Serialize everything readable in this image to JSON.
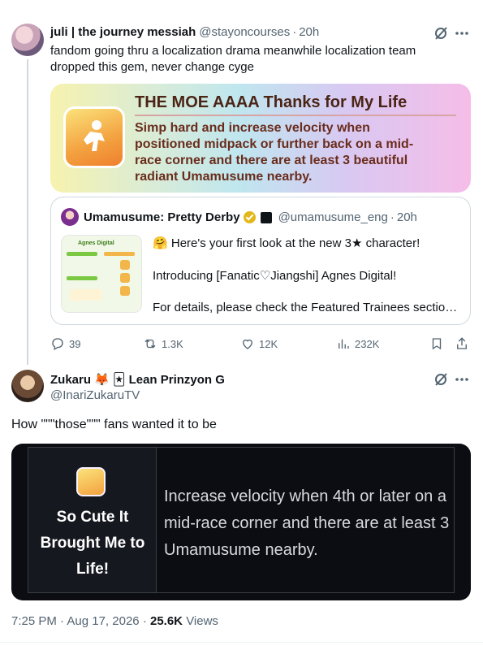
{
  "tweet1": {
    "display_name": "juli | the journey messiah",
    "handle": "@stayoncourses",
    "time": "20h",
    "text": "fandom going thru a localization drama meanwhile localization team dropped this gem, never change cyge",
    "image": {
      "title": "THE MOE AAAA Thanks for My Life",
      "body": "Simp hard and increase velocity when positioned midpack or further back on a mid-race corner and there are at least 3 beautiful radiant Umamusume nearby."
    },
    "quote": {
      "display_name": "Umamusume: Pretty Derby",
      "handle": "@umamusume_eng",
      "time": "20h",
      "thumb_title": "Agnes Digital",
      "lines": [
        "Here's your first look at the new 3★ character!",
        "Introducing [Fanatic♡Jiangshi] Agnes Digital!",
        "For details, please check the Featured Trainees sectio…"
      ]
    },
    "actions": {
      "replies": "39",
      "reposts": "1.3K",
      "likes": "12K",
      "views": "232K"
    }
  },
  "tweet2": {
    "display_name_a": "Zukaru",
    "display_name_b": "Lean Prinzyon G",
    "handle": "@InariZukaruTV",
    "text": "How \"\"\"those\"\"\" fans wanted it to be",
    "image": {
      "title": "So Cute It Brought Me to Life!",
      "desc": "Increase velocity when 4th or later on a mid-race corner and there are at least 3 Umamusume nearby."
    }
  },
  "footer": {
    "time": "7:25 PM",
    "date": "Aug 17, 2026",
    "views_count": "25.6K",
    "views_label": "Views"
  },
  "icons": [
    "grok-icon",
    "more-icon",
    "reply-icon",
    "repost-icon",
    "like-icon",
    "views-icon",
    "bookmark-icon",
    "share-icon",
    "verified-icon",
    "fox-emoji",
    "jester-emoji",
    "face-emoji"
  ],
  "colors": {
    "text": "#0f1419",
    "secondary": "#536471",
    "border": "#cfd9de",
    "verified": "#e2b719",
    "dark_card": "#0b0d12"
  }
}
